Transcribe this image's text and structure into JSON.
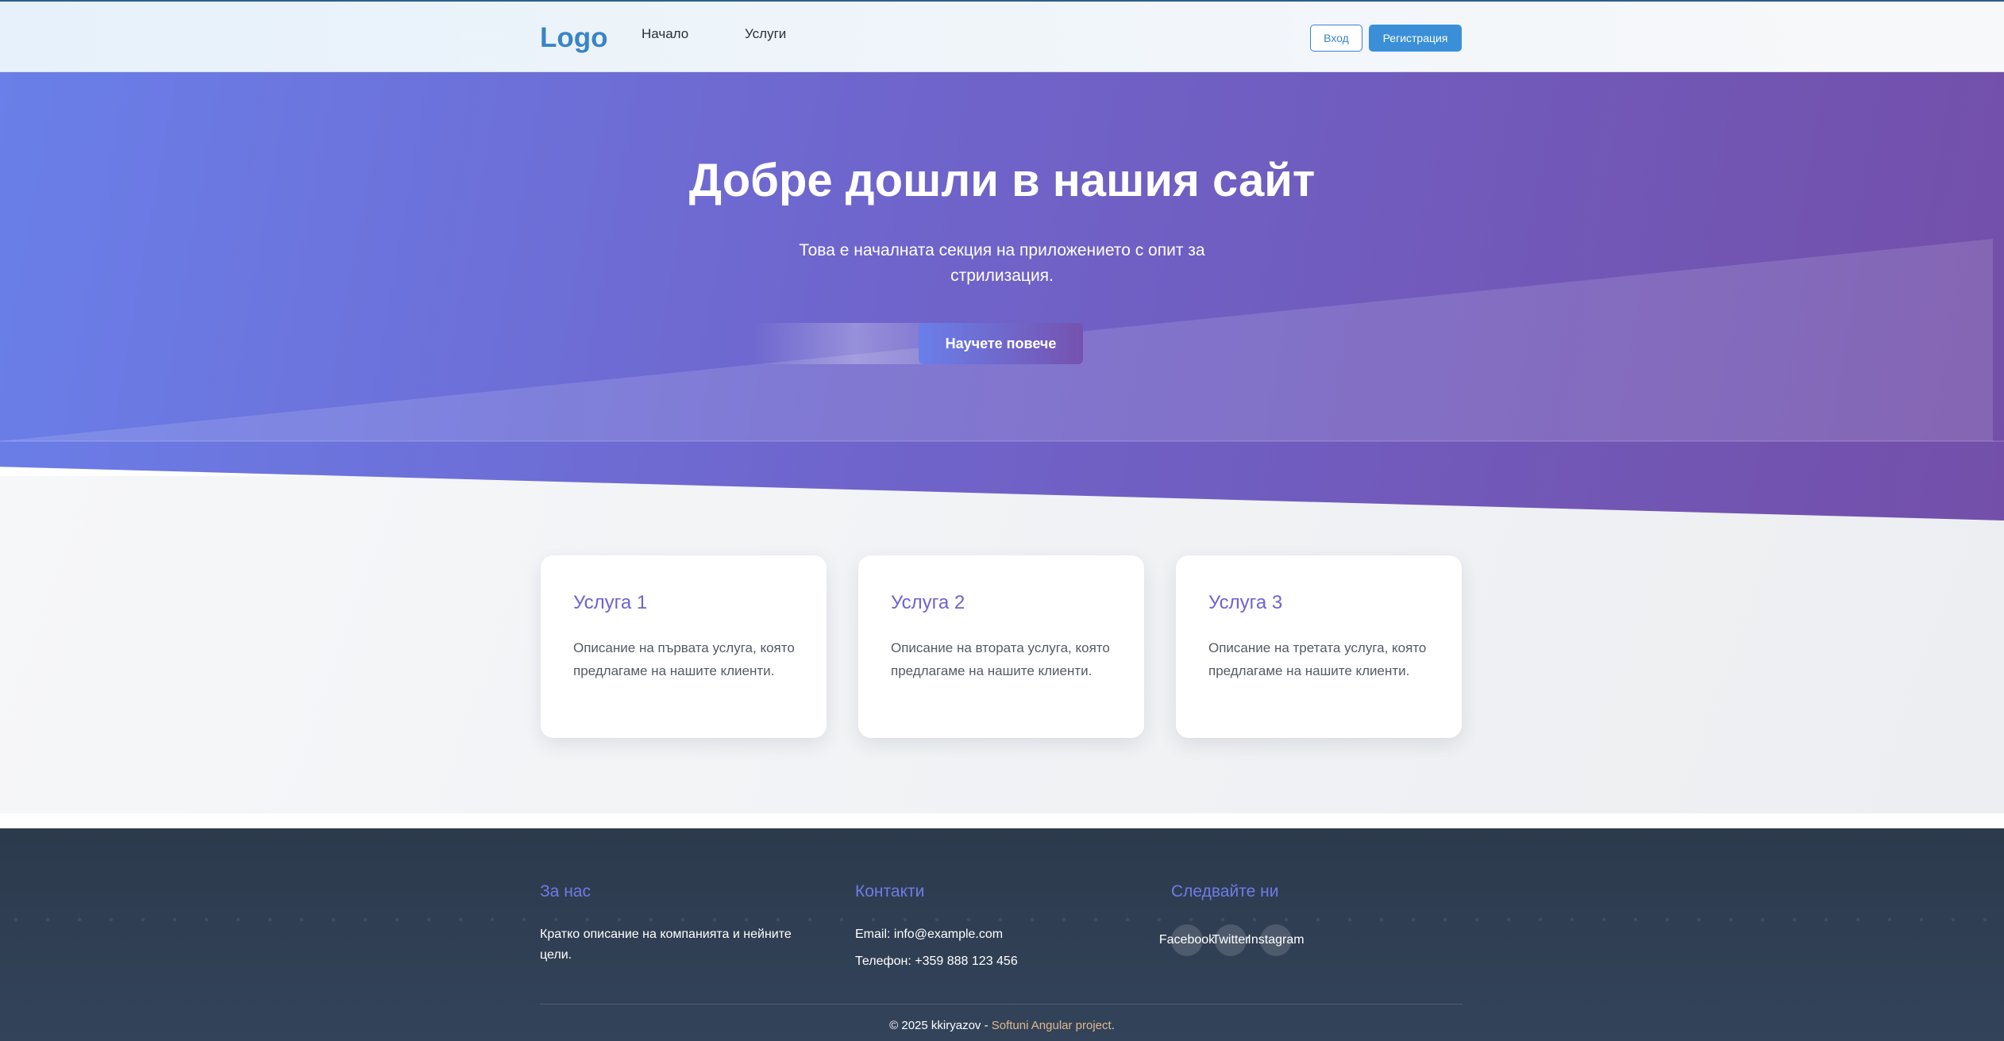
{
  "header": {
    "logo": "Logo",
    "nav": [
      {
        "label": "Начало"
      },
      {
        "label": "Услуги"
      }
    ],
    "login_label": "Вход",
    "register_label": "Регистрация"
  },
  "hero": {
    "title": "Добре дошли в нашия сайт",
    "subtitle": "Това е началната секция на приложението с опит за стрилизация.",
    "cta_label": "Научете повече"
  },
  "services": [
    {
      "title": "Услуга 1",
      "description": "Описание на първата услуга, която предлагаме на нашите клиенти."
    },
    {
      "title": "Услуга 2",
      "description": "Описание на втората услуга, която предлагаме на нашите клиенти."
    },
    {
      "title": "Услуга 3",
      "description": "Описание на третата услуга, която предлагаме на нашите клиенти."
    }
  ],
  "footer": {
    "about": {
      "heading": "За нас",
      "text": "Кратко описание на компанията и нейните цели."
    },
    "contacts": {
      "heading": "Контакти",
      "email": "Email: info@example.com",
      "phone": "Телефон: +359 888 123 456"
    },
    "follow": {
      "heading": "Следвайте ни",
      "links": [
        "Facebook",
        "Twitter",
        "Instagram"
      ]
    },
    "copyright_prefix": "© 2025 kkiryazov - ",
    "copyright_link": "Softuni Angular project",
    "copyright_suffix": "."
  },
  "colors": {
    "accent": "#3a8fd8",
    "logo": "#3a84c7",
    "hero_start": "#6a7fe9",
    "hero_end": "#734fa9",
    "card_title": "#6d63d1",
    "footer_bg": "#2c3a4c",
    "footer_heading": "#6f7be6"
  }
}
